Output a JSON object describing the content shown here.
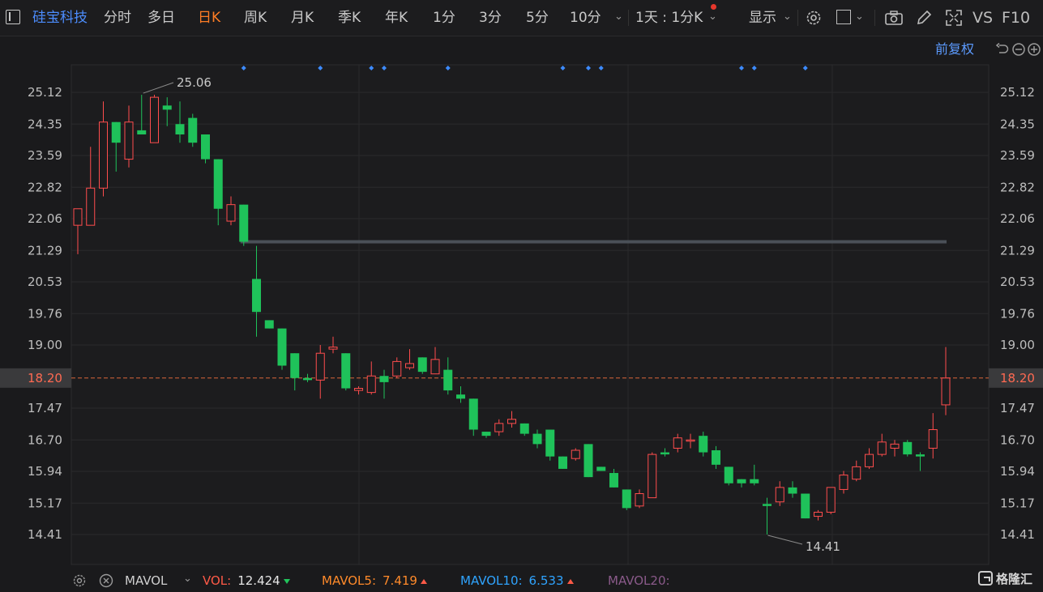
{
  "toolbar": {
    "stock_name": "硅宝科技",
    "periods": [
      "分时",
      "多日",
      "日K",
      "周K",
      "月K",
      "季K",
      "年K",
      "1分",
      "3分",
      "5分",
      "10分"
    ],
    "active_period": "日K",
    "interval_select": "1天 : 1分K",
    "display_label": "显示",
    "vs_label": "VS",
    "f10_label": "F10"
  },
  "chart_header": {
    "adjust_label": "前复权"
  },
  "chart_data": {
    "type": "candlestick",
    "title": "",
    "price_ticks": [
      "25.12",
      "24.35",
      "23.59",
      "22.82",
      "22.06",
      "21.29",
      "20.53",
      "19.76",
      "19.00",
      "18.20",
      "17.47",
      "16.70",
      "15.94",
      "15.17",
      "14.41"
    ],
    "ylim": [
      14.41,
      25.12
    ],
    "current_price": "18.20",
    "max_label": "25.06",
    "min_label": "14.41",
    "resistance_level": 21.5,
    "grid": true,
    "colors": {
      "up": "#ff4d4d",
      "down": "#1fc25a",
      "current_line": "#d9663a",
      "current_tag": "#3a3a3c"
    },
    "candles": [
      {
        "o": 21.9,
        "h": 22.3,
        "l": 21.2,
        "c": 22.3
      },
      {
        "o": 21.9,
        "h": 23.8,
        "l": 21.9,
        "c": 22.8
      },
      {
        "o": 22.8,
        "h": 24.9,
        "l": 22.6,
        "c": 24.4
      },
      {
        "o": 24.4,
        "h": 24.4,
        "l": 23.2,
        "c": 23.9
      },
      {
        "o": 23.5,
        "h": 24.8,
        "l": 23.3,
        "c": 24.4
      },
      {
        "o": 24.2,
        "h": 25.06,
        "l": 24.1,
        "c": 24.1
      },
      {
        "o": 23.9,
        "h": 25.06,
        "l": 23.9,
        "c": 25.0
      },
      {
        "o": 24.8,
        "h": 25.0,
        "l": 24.3,
        "c": 24.7
      },
      {
        "o": 24.35,
        "h": 24.9,
        "l": 23.9,
        "c": 24.1
      },
      {
        "o": 24.5,
        "h": 24.6,
        "l": 23.8,
        "c": 23.9
      },
      {
        "o": 24.1,
        "h": 24.1,
        "l": 23.4,
        "c": 23.5
      },
      {
        "o": 23.5,
        "h": 23.5,
        "l": 21.9,
        "c": 22.3
      },
      {
        "o": 22.0,
        "h": 22.6,
        "l": 21.9,
        "c": 22.4
      },
      {
        "o": 22.4,
        "h": 22.4,
        "l": 21.4,
        "c": 21.5
      },
      {
        "o": 20.6,
        "h": 21.4,
        "l": 19.2,
        "c": 19.8
      },
      {
        "o": 19.6,
        "h": 19.6,
        "l": 19.4,
        "c": 19.4
      },
      {
        "o": 19.4,
        "h": 19.4,
        "l": 18.4,
        "c": 18.5
      },
      {
        "o": 18.8,
        "h": 18.8,
        "l": 17.9,
        "c": 18.2
      },
      {
        "o": 18.2,
        "h": 18.3,
        "l": 18.1,
        "c": 18.15
      },
      {
        "o": 18.15,
        "h": 19.0,
        "l": 17.7,
        "c": 18.8
      },
      {
        "o": 18.9,
        "h": 19.2,
        "l": 18.8,
        "c": 18.95
      },
      {
        "o": 18.8,
        "h": 18.8,
        "l": 17.9,
        "c": 17.95
      },
      {
        "o": 17.9,
        "h": 18.0,
        "l": 17.8,
        "c": 17.95
      },
      {
        "o": 17.85,
        "h": 18.6,
        "l": 17.8,
        "c": 18.25
      },
      {
        "o": 18.25,
        "h": 18.4,
        "l": 17.7,
        "c": 18.1
      },
      {
        "o": 18.25,
        "h": 18.7,
        "l": 18.2,
        "c": 18.6
      },
      {
        "o": 18.45,
        "h": 18.9,
        "l": 18.4,
        "c": 18.55
      },
      {
        "o": 18.7,
        "h": 18.7,
        "l": 18.3,
        "c": 18.35
      },
      {
        "o": 18.3,
        "h": 18.95,
        "l": 18.3,
        "c": 18.65
      },
      {
        "o": 18.4,
        "h": 18.7,
        "l": 17.8,
        "c": 17.9
      },
      {
        "o": 17.8,
        "h": 18.0,
        "l": 17.6,
        "c": 17.7
      },
      {
        "o": 17.7,
        "h": 17.7,
        "l": 16.8,
        "c": 16.95
      },
      {
        "o": 16.9,
        "h": 16.9,
        "l": 16.75,
        "c": 16.8
      },
      {
        "o": 16.9,
        "h": 17.2,
        "l": 16.8,
        "c": 17.1
      },
      {
        "o": 17.1,
        "h": 17.4,
        "l": 17.0,
        "c": 17.2
      },
      {
        "o": 17.1,
        "h": 17.1,
        "l": 16.8,
        "c": 16.85
      },
      {
        "o": 16.85,
        "h": 16.95,
        "l": 16.5,
        "c": 16.6
      },
      {
        "o": 16.95,
        "h": 16.95,
        "l": 16.2,
        "c": 16.3
      },
      {
        "o": 16.3,
        "h": 16.3,
        "l": 16.0,
        "c": 16.0
      },
      {
        "o": 16.25,
        "h": 16.5,
        "l": 16.2,
        "c": 16.45
      },
      {
        "o": 16.6,
        "h": 16.6,
        "l": 15.8,
        "c": 15.8
      },
      {
        "o": 16.05,
        "h": 16.05,
        "l": 15.95,
        "c": 15.95
      },
      {
        "o": 15.9,
        "h": 16.0,
        "l": 15.55,
        "c": 15.55
      },
      {
        "o": 15.5,
        "h": 15.5,
        "l": 15.0,
        "c": 15.05
      },
      {
        "o": 15.1,
        "h": 15.5,
        "l": 15.05,
        "c": 15.4
      },
      {
        "o": 15.3,
        "h": 16.4,
        "l": 15.3,
        "c": 16.35
      },
      {
        "o": 16.4,
        "h": 16.5,
        "l": 16.3,
        "c": 16.35
      },
      {
        "o": 16.5,
        "h": 16.85,
        "l": 16.4,
        "c": 16.75
      },
      {
        "o": 16.7,
        "h": 16.85,
        "l": 16.5,
        "c": 16.7
      },
      {
        "o": 16.8,
        "h": 16.9,
        "l": 16.3,
        "c": 16.4
      },
      {
        "o": 16.45,
        "h": 16.55,
        "l": 16.0,
        "c": 16.1
      },
      {
        "o": 16.05,
        "h": 16.05,
        "l": 15.6,
        "c": 15.65
      },
      {
        "o": 15.75,
        "h": 15.75,
        "l": 15.55,
        "c": 15.65
      },
      {
        "o": 15.75,
        "h": 16.1,
        "l": 15.6,
        "c": 15.65
      },
      {
        "o": 15.15,
        "h": 15.3,
        "l": 14.41,
        "c": 15.1
      },
      {
        "o": 15.2,
        "h": 15.7,
        "l": 15.1,
        "c": 15.55
      },
      {
        "o": 15.55,
        "h": 15.7,
        "l": 15.3,
        "c": 15.4
      },
      {
        "o": 15.4,
        "h": 15.4,
        "l": 14.8,
        "c": 14.8
      },
      {
        "o": 14.85,
        "h": 15.0,
        "l": 14.75,
        "c": 14.95
      },
      {
        "o": 14.95,
        "h": 15.55,
        "l": 14.9,
        "c": 15.55
      },
      {
        "o": 15.5,
        "h": 15.95,
        "l": 15.4,
        "c": 15.85
      },
      {
        "o": 15.75,
        "h": 16.2,
        "l": 15.7,
        "c": 16.05
      },
      {
        "o": 16.05,
        "h": 16.5,
        "l": 16.0,
        "c": 16.35
      },
      {
        "o": 16.35,
        "h": 16.85,
        "l": 16.3,
        "c": 16.65
      },
      {
        "o": 16.5,
        "h": 16.7,
        "l": 16.3,
        "c": 16.6
      },
      {
        "o": 16.65,
        "h": 16.7,
        "l": 16.3,
        "c": 16.35
      },
      {
        "o": 16.35,
        "h": 16.4,
        "l": 15.95,
        "c": 16.3
      },
      {
        "o": 16.5,
        "h": 17.35,
        "l": 16.25,
        "c": 16.95
      },
      {
        "o": 17.55,
        "h": 18.95,
        "l": 17.3,
        "c": 18.2
      }
    ],
    "signal_markers": [
      13,
      19,
      23,
      24,
      29,
      38,
      40,
      41,
      52,
      53,
      57
    ]
  },
  "indicator": {
    "name": "MAVOL",
    "items": [
      {
        "label": "VOL:",
        "value": "12.424",
        "color": "#ff5a47",
        "trend": "down"
      },
      {
        "label": "MAVOL5:",
        "value": "7.419",
        "color": "#ff8a2a",
        "trend": "up"
      },
      {
        "label": "MAVOL10:",
        "value": "6.533",
        "color": "#2fa4ff",
        "trend": "up"
      },
      {
        "label": "MAVOL20:",
        "value": "",
        "color": "#8a5a8a",
        "trend": ""
      }
    ]
  },
  "watermark": "格隆汇"
}
